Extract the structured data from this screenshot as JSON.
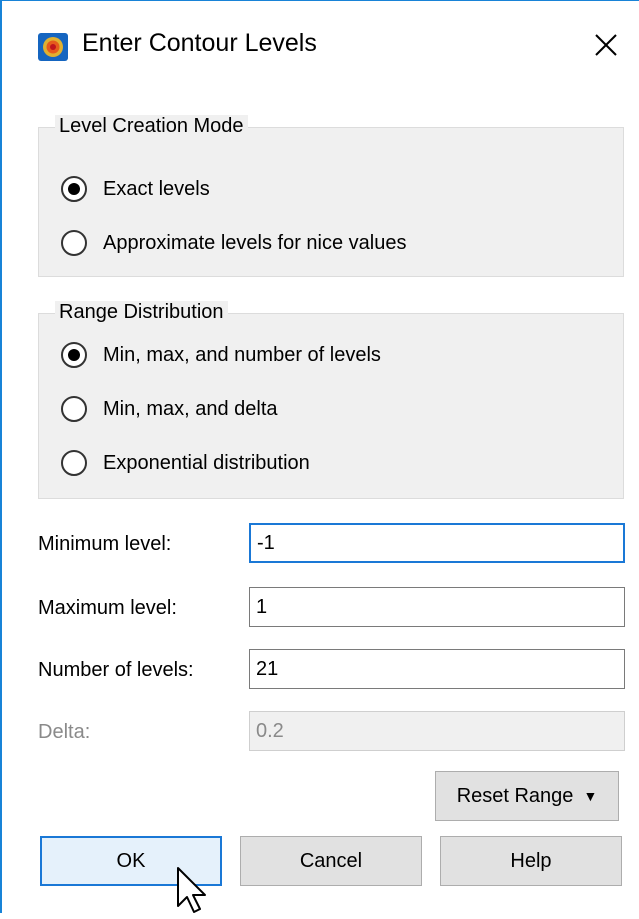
{
  "window": {
    "title": "Enter Contour Levels",
    "icon": "app-icon",
    "close_icon": "close-icon"
  },
  "level_creation_mode": {
    "legend": "Level Creation Mode",
    "options": [
      {
        "label": "Exact levels",
        "checked": true
      },
      {
        "label": "Approximate levels for nice values",
        "checked": false
      }
    ]
  },
  "range_distribution": {
    "legend": "Range Distribution",
    "options": [
      {
        "label": "Min, max, and number of levels",
        "checked": true
      },
      {
        "label": "Min, max, and delta",
        "checked": false
      },
      {
        "label": "Exponential distribution",
        "checked": false
      }
    ]
  },
  "fields": {
    "minimum": {
      "label": "Minimum level:",
      "value": "-1"
    },
    "maximum": {
      "label": "Maximum level:",
      "value": "1"
    },
    "number": {
      "label": "Number of levels:",
      "value": "21"
    },
    "delta": {
      "label": "Delta:",
      "value": "0.2",
      "disabled": true
    }
  },
  "buttons": {
    "reset_range": "Reset Range",
    "ok": "OK",
    "cancel": "Cancel",
    "help": "Help"
  },
  "colors": {
    "accent": "#1a78d6",
    "window_border": "#1883d7",
    "group_bg": "#f0f0f0"
  }
}
